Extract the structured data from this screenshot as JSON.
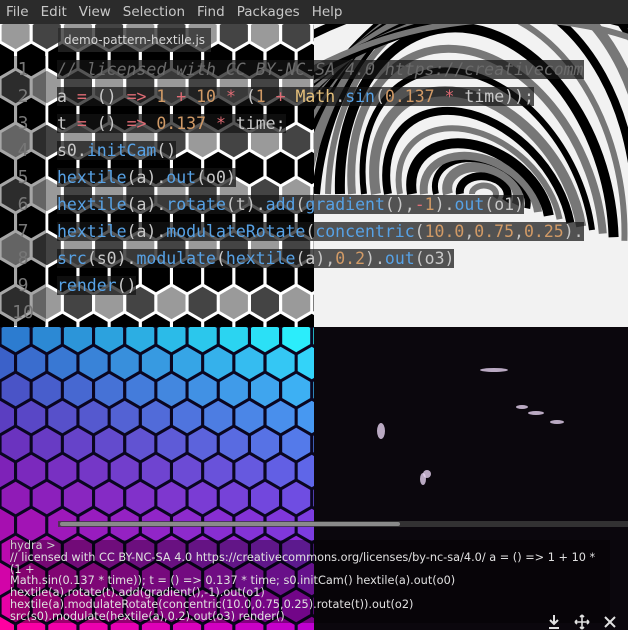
{
  "menu": [
    "File",
    "Edit",
    "View",
    "Selection",
    "Find",
    "Packages",
    "Help"
  ],
  "tab": {
    "title": "demo-pattern-hextile.js"
  },
  "editor": {
    "line_numbers": [
      "1",
      "2",
      "3",
      "4",
      "5",
      "6",
      "7",
      "8",
      "9",
      "10"
    ],
    "lines": [
      [
        [
          "c-comment",
          "// licensed with CC BY-NC-SA 4.0 https://creativecomm"
        ]
      ],
      [
        [
          "c-var",
          "a "
        ],
        [
          "c-op",
          "= "
        ],
        [
          "c-paren",
          "() "
        ],
        [
          "c-op",
          "=> "
        ],
        [
          "c-num",
          "1 "
        ],
        [
          "c-op",
          "+ "
        ],
        [
          "c-num",
          "10 "
        ],
        [
          "c-op",
          "* "
        ],
        [
          "c-paren",
          "("
        ],
        [
          "c-num",
          "1 "
        ],
        [
          "c-op",
          "+ "
        ],
        [
          "c-obj",
          "Math"
        ],
        [
          "c-paren",
          "."
        ],
        [
          "c-fn",
          "sin"
        ],
        [
          "c-paren",
          "("
        ],
        [
          "c-num",
          "0.137 "
        ],
        [
          "c-op",
          "* "
        ],
        [
          "c-var",
          "time"
        ],
        [
          "c-paren",
          "));"
        ]
      ],
      [
        [
          "c-var",
          "t "
        ],
        [
          "c-op",
          "= "
        ],
        [
          "c-paren",
          "() "
        ],
        [
          "c-op",
          "=> "
        ],
        [
          "c-num",
          "0.137 "
        ],
        [
          "c-op",
          "* "
        ],
        [
          "c-var",
          "time;"
        ]
      ],
      [
        [
          "c-var",
          "s0"
        ],
        [
          "c-paren",
          "."
        ],
        [
          "c-fn",
          "initCam"
        ],
        [
          "c-paren",
          "()"
        ]
      ],
      [
        [
          "c-fn",
          "hextile"
        ],
        [
          "c-paren",
          "(a)."
        ],
        [
          "c-fn",
          "out"
        ],
        [
          "c-paren",
          "(o0)"
        ]
      ],
      [
        [
          "c-fn",
          "hextile"
        ],
        [
          "c-paren",
          "(a)."
        ],
        [
          "c-fn",
          "rotate"
        ],
        [
          "c-paren",
          "(t)."
        ],
        [
          "c-fn",
          "add"
        ],
        [
          "c-paren",
          "("
        ],
        [
          "c-fn",
          "gradient"
        ],
        [
          "c-paren",
          "(),"
        ],
        [
          "c-op",
          "-"
        ],
        [
          "c-num",
          "1"
        ],
        [
          "c-paren",
          ")."
        ],
        [
          "c-fn",
          "out"
        ],
        [
          "c-paren",
          "(o1)"
        ]
      ],
      [
        [
          "c-fn",
          "hextile"
        ],
        [
          "c-paren",
          "(a)."
        ],
        [
          "c-fn",
          "modulateRotate"
        ],
        [
          "c-paren",
          "("
        ],
        [
          "c-fn",
          "concentric"
        ],
        [
          "c-paren",
          "("
        ],
        [
          "c-num",
          "10.0"
        ],
        [
          "c-paren",
          ","
        ],
        [
          "c-num",
          "0.75"
        ],
        [
          "c-paren",
          ","
        ],
        [
          "c-num",
          "0.25"
        ],
        [
          "c-paren",
          ")."
        ]
      ],
      [
        [
          "c-fn",
          "src"
        ],
        [
          "c-paren",
          "(s0)."
        ],
        [
          "c-fn",
          "modulate"
        ],
        [
          "c-paren",
          "("
        ],
        [
          "c-fn",
          "hextile"
        ],
        [
          "c-paren",
          "(a),"
        ],
        [
          "c-num",
          "0.2"
        ],
        [
          "c-paren",
          ")."
        ],
        [
          "c-fn",
          "out"
        ],
        [
          "c-paren",
          "(o3)"
        ]
      ],
      [
        [
          "c-fn",
          "render"
        ],
        [
          "c-paren",
          "()"
        ]
      ],
      []
    ]
  },
  "console": {
    "prompt": "hydra >",
    "lines": [
      "// licensed with CC BY-NC-SA 4.0 https://creativecommons.org/licenses/by-nc-sa/4.0/ a = () => 1 + 10 * (1 +",
      "Math.sin(0.137 * time)); t = () => 0.137 * time; s0.initCam() hextile(a).out(o0)",
      "hextile(a).rotate(t).add(gradient(),-1).out(o1)",
      "hextile(a).modulateRotate(concentric(10.0,0.75,0.25).rotate(t)).out(o2)",
      "src(s0).modulate(hextile(a),0.2).out(o3) render()"
    ]
  },
  "colors": {
    "menubar_bg": "#2b2b2b",
    "function": "#57a2e6",
    "number": "#d19a66",
    "operator": "#e06c75",
    "comment": "#6b6b6b"
  },
  "icons": [
    "download-icon",
    "move-icon",
    "close-icon"
  ]
}
